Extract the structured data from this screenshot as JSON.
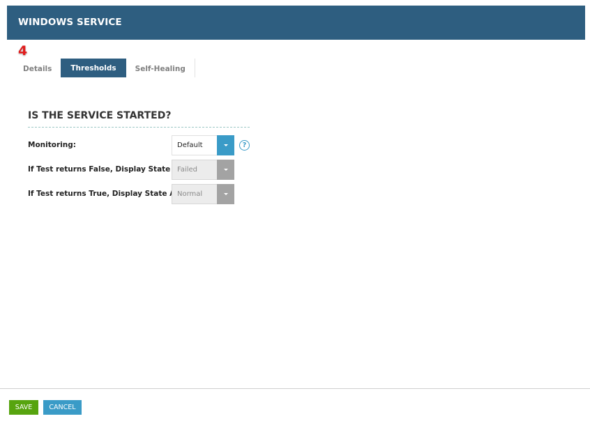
{
  "dialog": {
    "title": "WINDOWS SERVICE"
  },
  "step_badge": "4",
  "tabs": [
    {
      "label": "Details",
      "active": false
    },
    {
      "label": "Thresholds",
      "active": true
    },
    {
      "label": "Self-Healing",
      "active": false
    }
  ],
  "section": {
    "title": "IS THE SERVICE STARTED?",
    "fields": [
      {
        "label": "Monitoring:",
        "value": "Default",
        "enabled": true,
        "has_help": true
      },
      {
        "label": "If Test returns False, Display State As:",
        "value": "Failed",
        "enabled": false
      },
      {
        "label": "If Test returns True, Display State As:",
        "value": "Normal",
        "enabled": false
      }
    ],
    "help_glyph": "?"
  },
  "footer": {
    "save_label": "SAVE",
    "cancel_label": "CANCEL"
  },
  "colors": {
    "header_bg": "#2e5e80",
    "accent_blue": "#3a9bc7",
    "save_green": "#57a40f",
    "badge_red": "#e11d1d"
  },
  "icons": {
    "dropdown": "chevron-down-icon",
    "help": "help-circle-icon"
  }
}
